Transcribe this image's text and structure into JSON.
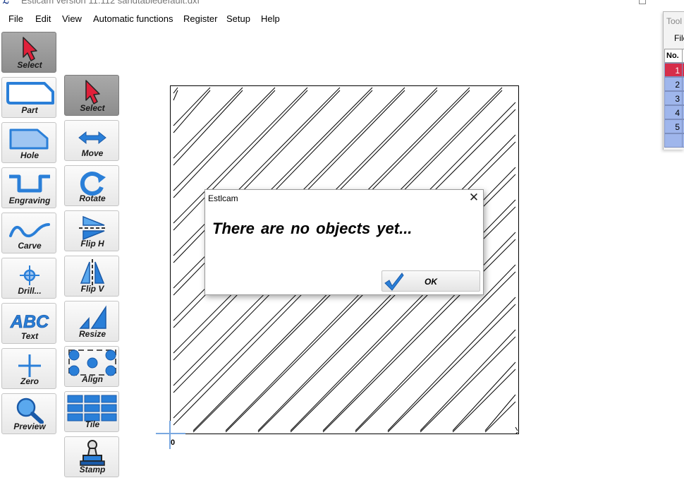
{
  "window": {
    "title": "Estlcam version 11.112 sandtabledefault.dxf",
    "app_icon": "estlcam-logo-icon"
  },
  "menu": [
    "File",
    "Edit",
    "View",
    "Automatic functions",
    "Register",
    "Setup",
    "Help"
  ],
  "left_toolbar": [
    {
      "label": "Select",
      "icon": "select-arrow-icon",
      "active": true
    },
    {
      "label": "Part",
      "icon": "part-icon"
    },
    {
      "label": "Hole",
      "icon": "hole-icon"
    },
    {
      "label": "Engraving",
      "icon": "engraving-icon"
    },
    {
      "label": "Carve",
      "icon": "carve-icon"
    },
    {
      "label": "Drill...",
      "icon": "drill-icon"
    },
    {
      "label": "Text",
      "icon": "text-icon",
      "glyph": "ABC"
    },
    {
      "label": "Zero",
      "icon": "zero-icon"
    },
    {
      "label": "Preview",
      "icon": "preview-icon"
    }
  ],
  "edit_toolbar": [
    {
      "label": "Select",
      "icon": "select-arrow-icon",
      "active": true
    },
    {
      "label": "Move",
      "icon": "move-icon"
    },
    {
      "label": "Rotate",
      "icon": "rotate-icon"
    },
    {
      "label": "Flip H",
      "icon": "flip-h-icon"
    },
    {
      "label": "Flip V",
      "icon": "flip-v-icon"
    },
    {
      "label": "Resize",
      "icon": "resize-icon"
    },
    {
      "label": "Align",
      "icon": "align-icon"
    },
    {
      "label": "Tile",
      "icon": "tile-icon"
    },
    {
      "label": "Stamp",
      "icon": "stamp-icon"
    }
  ],
  "canvas": {
    "origin_label": "0"
  },
  "dialog": {
    "title": "Estlcam",
    "message": "There are no objects yet...",
    "ok_label": "OK",
    "close_icon": "close-icon",
    "ok_icon": "checkmark-icon"
  },
  "tool_window": {
    "title": "Tool",
    "menu": "File",
    "column_header": "No.",
    "rows": [
      "1",
      "2",
      "3",
      "4",
      "5"
    ],
    "selected_row": 0,
    "colors": {
      "selected": "#d62e4a",
      "row": "#9fb6ec"
    }
  },
  "colors": {
    "accent_blue": "#2a7fd8",
    "select_red": "#e0203a",
    "active_button": "#9a9a9a"
  }
}
